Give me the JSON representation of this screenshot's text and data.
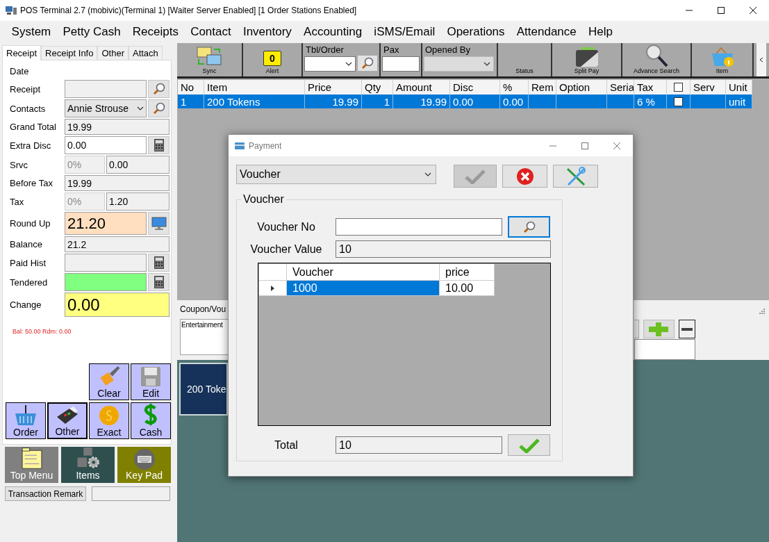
{
  "window": {
    "title": "POS Terminal 2.7 (mobivic)(Terminal 1) [Waiter Server Enabled] [1 Order Stations Enabled]"
  },
  "menu": [
    "System",
    "Petty Cash",
    "Receipts",
    "Contact",
    "Inventory",
    "Accounting",
    "iSMS/Email",
    "Operations",
    "Attendance",
    "Help"
  ],
  "receipt_tabs": [
    {
      "label": "Receipt",
      "selected": true
    },
    {
      "label": "Receipt Info",
      "selected": false
    },
    {
      "label": "Other",
      "selected": false
    },
    {
      "label": "Attach",
      "selected": false
    }
  ],
  "receipt_fields": [
    {
      "label": "Date",
      "kind": "plain"
    },
    {
      "label": "Receipt",
      "kind": "search"
    },
    {
      "label": "Contacts",
      "kind": "combo",
      "value": "Annie Strouse"
    },
    {
      "label": "Grand Total",
      "kind": "text",
      "value": "19.99"
    },
    {
      "label": "Extra Disc",
      "kind": "calc",
      "editable": true,
      "value": "0.00"
    },
    {
      "label": "Srvc",
      "kind": "split",
      "rate": "0%",
      "value": "0.00"
    },
    {
      "label": "Before Tax",
      "kind": "text",
      "value": "19.99"
    },
    {
      "label": "Tax",
      "kind": "split",
      "rate": "0%",
      "value": "1.20"
    },
    {
      "label": "Round Up",
      "kind": "monitor",
      "value": "21.20",
      "color": "#ffdfc0"
    },
    {
      "label": "Balance",
      "kind": "text",
      "value": "21.2"
    },
    {
      "label": "Paid Hist",
      "kind": "calc",
      "editable": false
    },
    {
      "label": "Tendered",
      "kind": "calc",
      "color": "#80ff80"
    },
    {
      "label": "Change",
      "kind": "total",
      "value": "0.00",
      "color": "#ffff80"
    }
  ],
  "balance_note": "Bal: 50.00 Rdm: 0.00",
  "payment_buttons": [
    [
      {
        "label": "Clear",
        "selected": false
      },
      {
        "label": "Edit",
        "selected": false
      }
    ],
    [
      {
        "label": "Order",
        "selected": false
      },
      {
        "label": "Other",
        "selected": true
      },
      {
        "label": "Exact",
        "selected": false
      },
      {
        "label": "Cash",
        "selected": false
      }
    ]
  ],
  "shortcut_tiles": [
    {
      "label": "Top Menu",
      "color": "#808080"
    },
    {
      "label": "Items",
      "color": "#2f4f4f"
    },
    {
      "label": "Key Pad",
      "color": "#808000"
    }
  ],
  "remark": {
    "button": "Transaction Remark"
  },
  "toolbar": [
    {
      "kind": "button",
      "label": "Sync"
    },
    {
      "kind": "alert",
      "label": "Alert",
      "count": "0"
    },
    {
      "kind": "combo_search",
      "label": "Tbl/Order"
    },
    {
      "kind": "field",
      "label": "Pax"
    },
    {
      "kind": "combo",
      "label": "Opened By",
      "disabled": true
    },
    {
      "kind": "button",
      "label": "Status"
    },
    {
      "kind": "button",
      "label": "Split Pay"
    },
    {
      "kind": "button",
      "label": "Advance Search"
    },
    {
      "kind": "button",
      "label": "Item"
    }
  ],
  "order_grid": {
    "columns": [
      {
        "kind": "text",
        "label": "No"
      },
      {
        "kind": "text",
        "label": "Item"
      },
      {
        "kind": "text",
        "label": "Price"
      },
      {
        "kind": "text",
        "label": "Qty"
      },
      {
        "kind": "text",
        "label": "Amount"
      },
      {
        "kind": "text",
        "label": "Disc"
      },
      {
        "kind": "text",
        "label": "%"
      },
      {
        "kind": "text",
        "label": "Rem"
      },
      {
        "kind": "text",
        "label": "Option"
      },
      {
        "kind": "text",
        "label": "Seria"
      },
      {
        "kind": "text",
        "label": "Tax"
      },
      {
        "kind": "checkbox",
        "checked": false
      },
      {
        "kind": "text",
        "label": "Serv"
      },
      {
        "kind": "text",
        "label": "Unit"
      }
    ],
    "rows": [
      {
        "selected": true,
        "no": "1",
        "item": "200 Tokens",
        "price": "19.99",
        "qty": "1",
        "amount": "19.99",
        "disc": "0.00",
        "pct": "0.00",
        "tax": "6 %",
        "checked": false,
        "unit": "unit"
      }
    ]
  },
  "coupon": {
    "label": "Coupon/Vou",
    "text": "Entertainment"
  },
  "item_tiles": [
    {
      "label": "200 Toke"
    }
  ],
  "payment_dialog": {
    "title": "Payment",
    "method": "Voucher",
    "ok_disabled": true,
    "group": "Voucher",
    "voucher_no_label": "Voucher No",
    "voucher_value_label": "Voucher Value",
    "voucher_value": "10",
    "table": {
      "columns": [
        "Voucher",
        "price"
      ],
      "rows": [
        {
          "selected": true,
          "voucher": "1000",
          "price": "10.00"
        }
      ]
    },
    "total_label": "Total",
    "total": "10"
  }
}
